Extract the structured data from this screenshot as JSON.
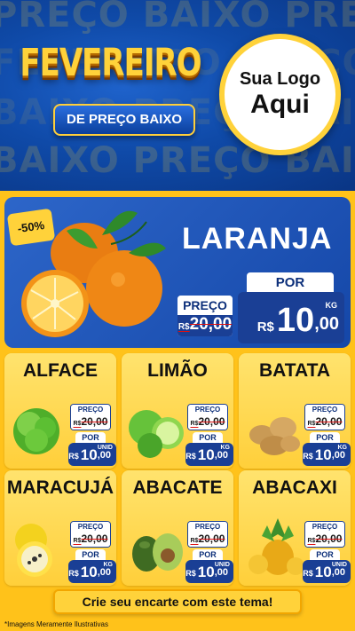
{
  "header": {
    "bg_words": [
      "PREÇO BAIXO PREÇO",
      "FEVEREIRO PREÇO",
      "BAIXO PREÇO BAIXO",
      "BAIXO PREÇO BAIXO"
    ],
    "title_main": "FEVEREIRO",
    "title_sub": "DE PREÇO BAIXO",
    "logo_line1": "Sua Logo",
    "logo_line2": "Aqui"
  },
  "featured": {
    "name": "LARANJA",
    "discount": "-50%",
    "old_label": "PREÇO",
    "old_currency": "R$",
    "old_price": "20,00",
    "new_label": "POR",
    "currency": "R$",
    "price_int": "10",
    "price_dec": ",00",
    "unit": "KG"
  },
  "products": [
    {
      "name": "ALFACE",
      "old_label": "PREÇO",
      "old_currency": "R$",
      "old_price": "20,00",
      "new_label": "POR",
      "currency": "R$",
      "price_int": "10",
      "price_dec": ",00",
      "unit": "UNID"
    },
    {
      "name": "LIMÃO",
      "old_label": "PREÇO",
      "old_currency": "R$",
      "old_price": "20,00",
      "new_label": "POR",
      "currency": "R$",
      "price_int": "10",
      "price_dec": ",00",
      "unit": "KG"
    },
    {
      "name": "BATATA",
      "old_label": "PREÇO",
      "old_currency": "R$",
      "old_price": "20,00",
      "new_label": "POR",
      "currency": "R$",
      "price_int": "10",
      "price_dec": ",00",
      "unit": "KG"
    },
    {
      "name": "MARACUJÁ",
      "old_label": "PREÇO",
      "old_currency": "R$",
      "old_price": "20,00",
      "new_label": "POR",
      "currency": "R$",
      "price_int": "10",
      "price_dec": ",00",
      "unit": "KG"
    },
    {
      "name": "ABACATE",
      "old_label": "PREÇO",
      "old_currency": "R$",
      "old_price": "20,00",
      "new_label": "POR",
      "currency": "R$",
      "price_int": "10",
      "price_dec": ",00",
      "unit": "UNID"
    },
    {
      "name": "ABACAXI",
      "old_label": "PREÇO",
      "old_currency": "R$",
      "old_price": "20,00",
      "new_label": "POR",
      "currency": "R$",
      "price_int": "10",
      "price_dec": ",00",
      "unit": "UNID"
    }
  ],
  "cta": "Crie seu encarte com este tema!",
  "disclaimer": "*Imagens Meramente Ilustrativas",
  "colors": {
    "blue": "#1547a8",
    "yellow": "#ffc21a",
    "navy": "#1a3f95",
    "strike": "#d11111"
  }
}
